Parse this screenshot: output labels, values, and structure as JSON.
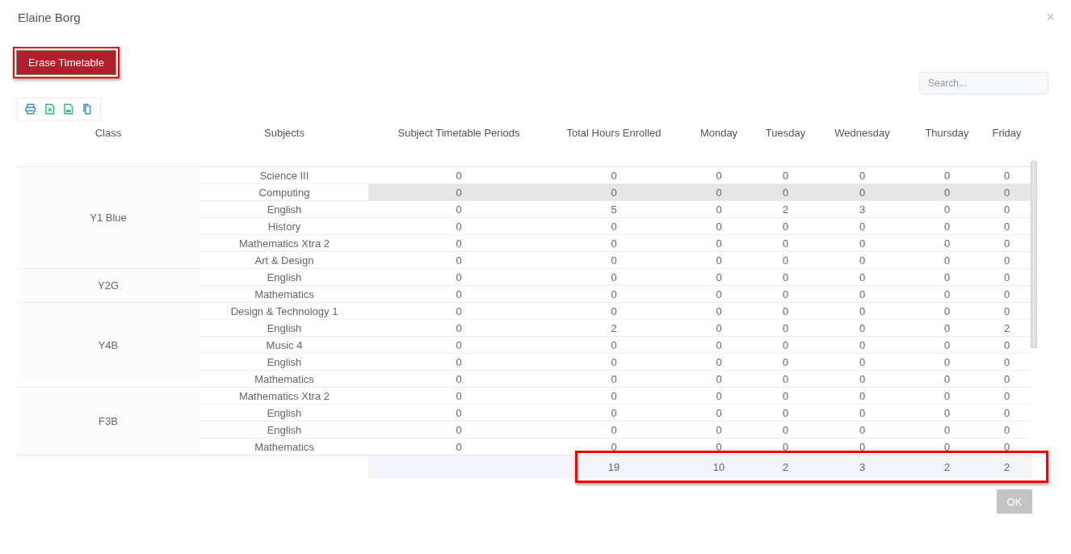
{
  "dialog": {
    "title": "Elaine Borg",
    "close": "×"
  },
  "erase_button": {
    "label": "Erase Timetable",
    "annotated": true
  },
  "search": {
    "placeholder": "Search..."
  },
  "table": {
    "columns": [
      "Class",
      "Subjects",
      "Subject Timetable Periods",
      "Total Hours Enrolled",
      "Monday",
      "Tuesday",
      "Wednesday",
      "Thursday",
      "Friday"
    ],
    "groups": [
      {
        "class": "Y1 Blue",
        "rows": [
          {
            "subject": "Science III",
            "values": [
              "0",
              "0",
              "0",
              "0",
              "0",
              "0",
              "0"
            ],
            "selected": false
          },
          {
            "subject": "Computing",
            "values": [
              "0",
              "0",
              "0",
              "0",
              "0",
              "0",
              "0"
            ],
            "selected": true
          },
          {
            "subject": "English",
            "values": [
              "0",
              "5",
              "0",
              "2",
              "3",
              "0",
              "0"
            ],
            "selected": false
          },
          {
            "subject": "History",
            "values": [
              "0",
              "0",
              "0",
              "0",
              "0",
              "0",
              "0"
            ],
            "selected": false
          },
          {
            "subject": "Mathematics Xtra 2",
            "values": [
              "0",
              "0",
              "0",
              "0",
              "0",
              "0",
              "0"
            ],
            "selected": false
          },
          {
            "subject": "Art & Design",
            "values": [
              "0",
              "0",
              "0",
              "0",
              "0",
              "0",
              "0"
            ],
            "selected": false
          }
        ]
      },
      {
        "class": "Y2G",
        "rows": [
          {
            "subject": "English",
            "values": [
              "0",
              "0",
              "0",
              "0",
              "0",
              "0",
              "0"
            ],
            "selected": false
          },
          {
            "subject": "Mathematics",
            "values": [
              "0",
              "0",
              "0",
              "0",
              "0",
              "0",
              "0"
            ],
            "selected": false
          }
        ]
      },
      {
        "class": "Y4B",
        "rows": [
          {
            "subject": "Design & Technology 1",
            "values": [
              "0",
              "0",
              "0",
              "0",
              "0",
              "0",
              "0"
            ],
            "selected": false
          },
          {
            "subject": "English",
            "values": [
              "0",
              "2",
              "0",
              "0",
              "0",
              "0",
              "2"
            ],
            "selected": false
          },
          {
            "subject": "Music 4",
            "values": [
              "0",
              "0",
              "0",
              "0",
              "0",
              "0",
              "0"
            ],
            "selected": false
          },
          {
            "subject": "English",
            "values": [
              "0",
              "0",
              "0",
              "0",
              "0",
              "0",
              "0"
            ],
            "selected": false
          },
          {
            "subject": "Mathematics",
            "values": [
              "0",
              "0",
              "0",
              "0",
              "0",
              "0",
              "0"
            ],
            "selected": false
          }
        ]
      },
      {
        "class": "F3B",
        "rows": [
          {
            "subject": "Mathematics Xtra 2",
            "values": [
              "0",
              "0",
              "0",
              "0",
              "0",
              "0",
              "0"
            ],
            "selected": false
          },
          {
            "subject": "English",
            "values": [
              "0",
              "0",
              "0",
              "0",
              "0",
              "0",
              "0"
            ],
            "selected": false
          },
          {
            "subject": "English",
            "values": [
              "0",
              "0",
              "0",
              "0",
              "0",
              "0",
              "0"
            ],
            "selected": false
          },
          {
            "subject": "Mathematics",
            "values": [
              "0",
              "0",
              "0",
              "0",
              "0",
              "0",
              "0"
            ],
            "selected": false
          }
        ]
      }
    ],
    "totals": {
      "values": [
        "19",
        "10",
        "2",
        "3",
        "2",
        "2"
      ],
      "annotated": true
    }
  },
  "ok_button": "OK"
}
